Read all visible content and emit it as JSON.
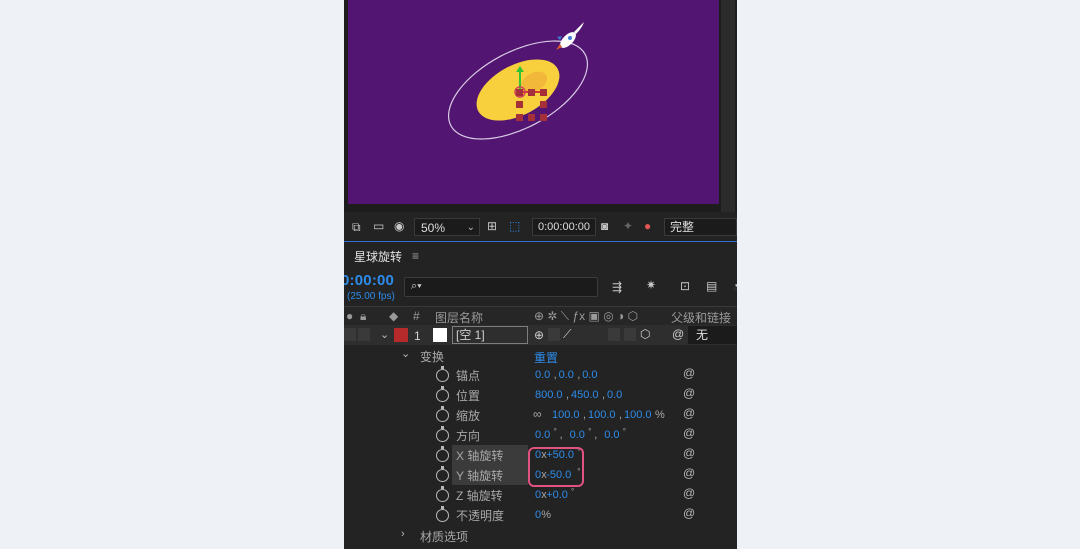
{
  "viewer": {
    "zoom": "50%",
    "timecode": "0:00:00:00",
    "quality": "完整"
  },
  "timeline": {
    "tab_label": "星球旋转",
    "menu_icon": "hamburger-icon",
    "current_time": "0:00:00",
    "fps": "(25.00 fps)",
    "search_placeholder": "",
    "columns": {
      "number": "#",
      "layer_name": "图层名称",
      "parent": "父级和链接"
    },
    "layer": {
      "number": "1",
      "name": "[空 1]",
      "parent_value": "无",
      "label_color": "#b52b2b"
    },
    "transform": {
      "label": "变换",
      "reset": "重置",
      "properties": [
        {
          "label": "锚点",
          "values": [
            "0.0",
            ",",
            "0.0",
            ",",
            "0.0"
          ]
        },
        {
          "label": "位置",
          "values": [
            "800.0",
            ",",
            "450.0",
            ",",
            "0.0"
          ]
        },
        {
          "label": "缩放",
          "values": [
            "100.0",
            ",",
            "100.0",
            ",",
            "100.0",
            "%"
          ]
        },
        {
          "label": "方向",
          "values": [
            "0.0",
            "°",
            " ,",
            "0.0",
            "°",
            " ,",
            "0.0",
            "°"
          ]
        },
        {
          "label": "X 轴旋转",
          "values": [
            "0",
            "x",
            "+50.0",
            "°"
          ]
        },
        {
          "label": "Y 轴旋转",
          "values": [
            "0",
            "x",
            "-50.0",
            "°"
          ]
        },
        {
          "label": "Z 轴旋转",
          "values": [
            "0",
            "x",
            "+0.0",
            "°"
          ]
        },
        {
          "label": "不透明度",
          "values": [
            "0",
            "%"
          ]
        }
      ]
    },
    "material": {
      "label": "材质选项"
    }
  }
}
